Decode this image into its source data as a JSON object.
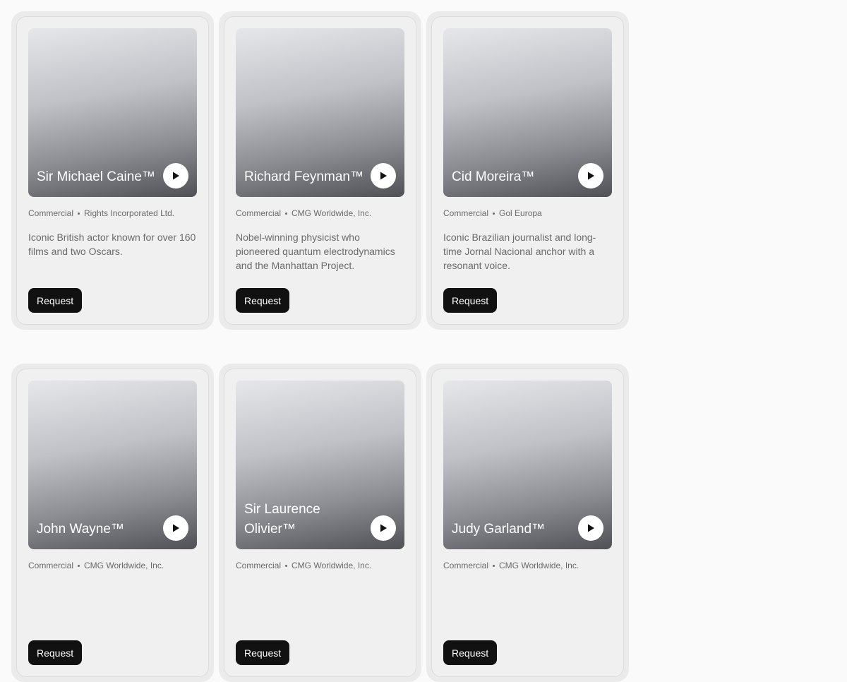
{
  "cards": [
    {
      "name": "Sir Michael Caine™",
      "category": "Commercial",
      "agency": "Rights Incorporated Ltd.",
      "description": "Iconic British actor known for over 160 films and two Oscars.",
      "button": "Request"
    },
    {
      "name": "Richard Feynman™",
      "category": "Commercial",
      "agency": "CMG Worldwide, Inc.",
      "description": "Nobel-winning physicist who pioneered quantum electrodynamics and the Manhattan Project.",
      "button": "Request"
    },
    {
      "name": "Cid Moreira™",
      "category": "Commercial",
      "agency": "Gol Europa",
      "description": "Iconic Brazilian journalist and long-time Jornal Nacional anchor with a resonant voice.",
      "button": "Request"
    },
    {
      "name": "John Wayne™",
      "category": "Commercial",
      "agency": "CMG Worldwide, Inc.",
      "description": "",
      "button": "Request"
    },
    {
      "name": "Sir Laurence Olivier™",
      "category": "Commercial",
      "agency": "CMG Worldwide, Inc.",
      "description": "",
      "button": "Request"
    },
    {
      "name": "Judy Garland™",
      "category": "Commercial",
      "agency": "CMG Worldwide, Inc.",
      "description": "",
      "button": "Request"
    }
  ],
  "icons": {
    "play": "play-icon"
  }
}
